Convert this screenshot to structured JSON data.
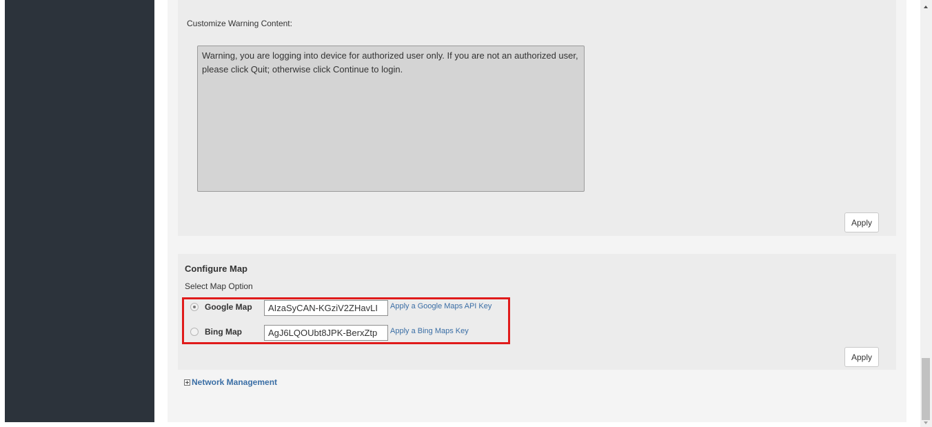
{
  "warning_panel": {
    "label": "Customize Warning Content:",
    "content": "Warning, you are logging into device for authorized user only. If you are not an authorized user, please click Quit; otherwise click Continue to login.",
    "apply_label": "Apply"
  },
  "map_panel": {
    "title": "Configure Map",
    "select_label": "Select Map Option",
    "options": [
      {
        "label": "Google Map",
        "selected": true,
        "key_value": "AIzaSyCAN-KGziV2ZHavLI",
        "link_text": "Apply a Google Maps API Key"
      },
      {
        "label": "Bing Map",
        "selected": false,
        "key_value": "AgJ6LQOUbt8JPK-BerxZtp",
        "link_text": "Apply a Bing Maps Key"
      }
    ],
    "apply_label": "Apply",
    "highlight_color": "#e01b1b"
  },
  "network_management": {
    "label": "Network Management",
    "icon": "expand-plus-icon"
  },
  "colors": {
    "sidebar": "#2c333b",
    "link": "#3a6ea5",
    "panel": "#ececec"
  }
}
